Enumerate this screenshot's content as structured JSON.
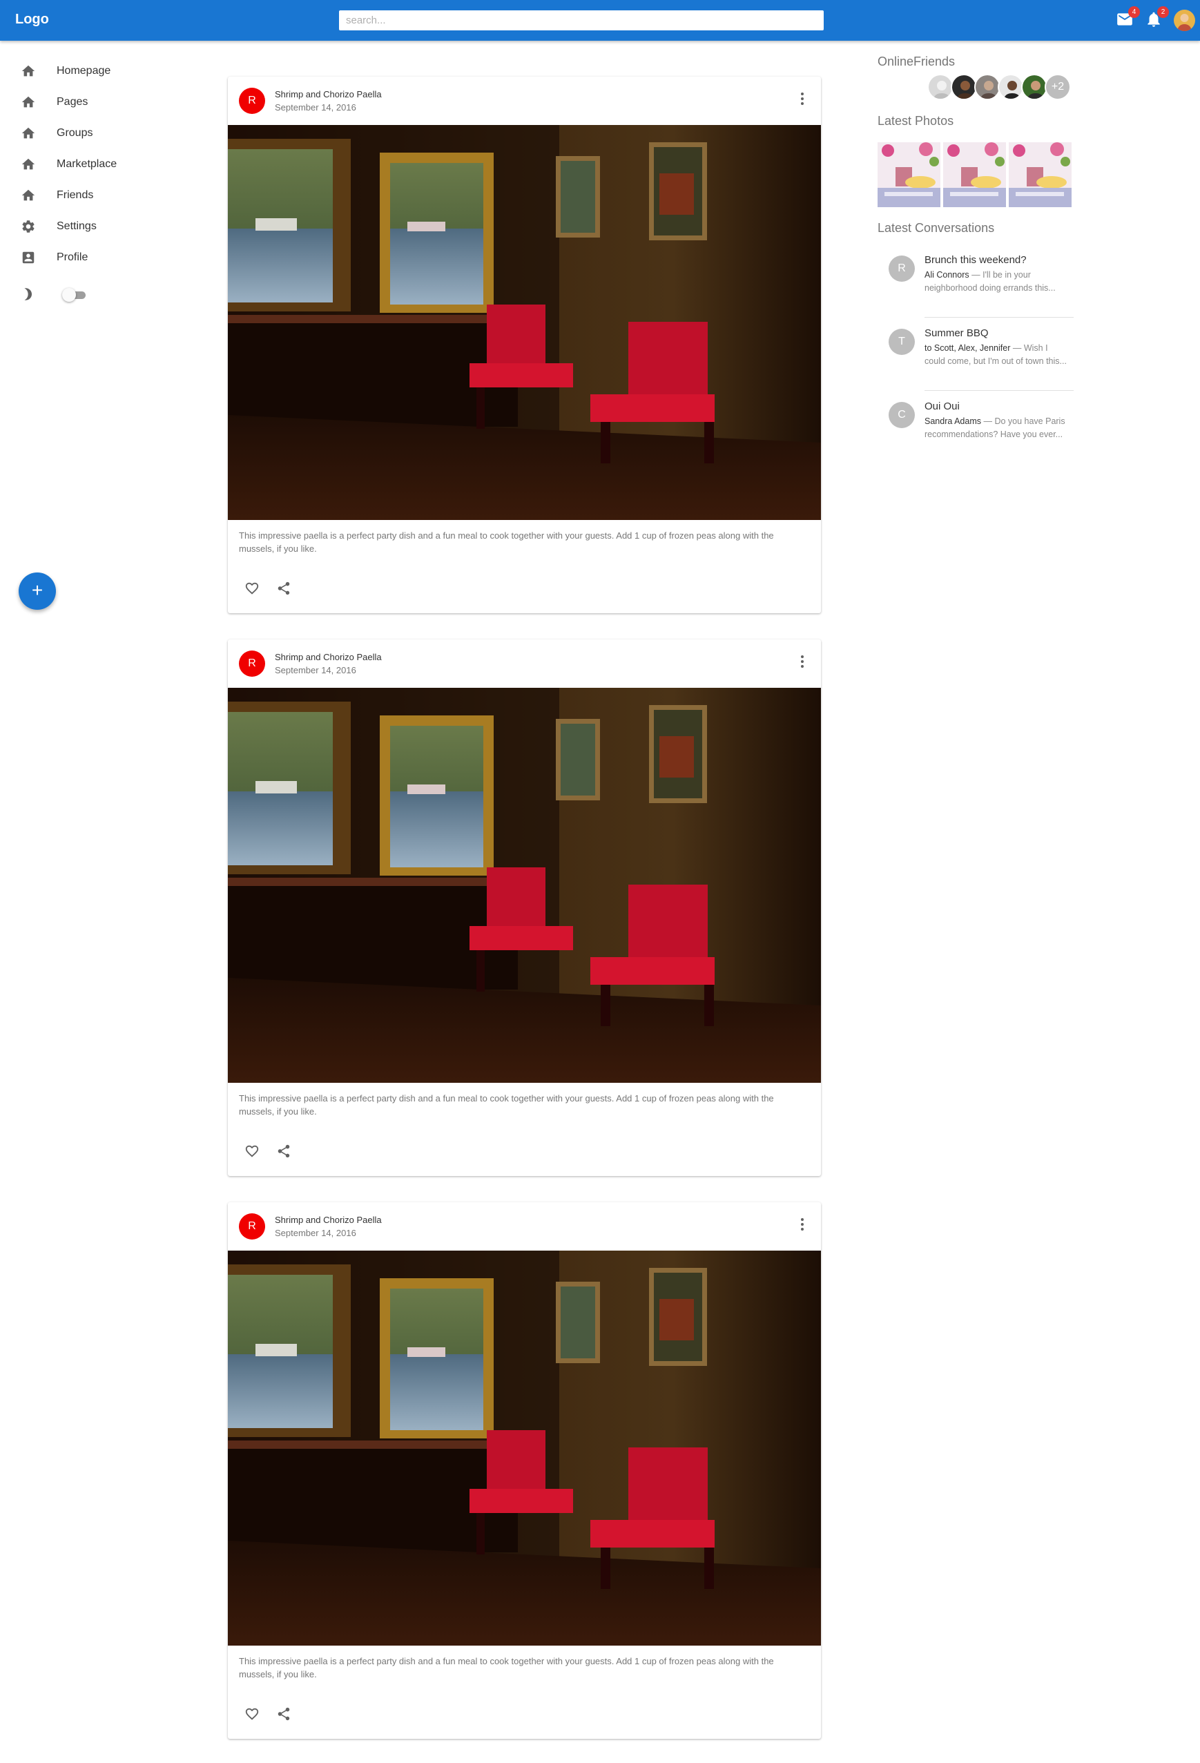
{
  "appbar": {
    "logo": "Logo",
    "search_placeholder": "search...",
    "mail_badge": "4",
    "notifications_badge": "2",
    "icons": [
      "mail-icon",
      "bell-icon"
    ]
  },
  "sidebar": {
    "items": [
      {
        "label": "Homepage",
        "icon": "home-icon"
      },
      {
        "label": "Pages",
        "icon": "home-icon"
      },
      {
        "label": "Groups",
        "icon": "home-icon"
      },
      {
        "label": "Marketplace",
        "icon": "home-icon"
      },
      {
        "label": "Friends",
        "icon": "home-icon"
      },
      {
        "label": "Settings",
        "icon": "gear-icon"
      },
      {
        "label": "Profile",
        "icon": "account-box-icon"
      }
    ],
    "dark_mode_enabled": false,
    "fab_label": "+"
  },
  "posts": [
    {
      "avatar": "R",
      "title": "Shrimp and Chorizo Paella",
      "date": "September 14, 2016",
      "description": "This impressive paella is a perfect party dish and a fun meal to cook together with your guests. Add 1 cup of frozen peas along with the mussels, if you like."
    },
    {
      "avatar": "R",
      "title": "Shrimp and Chorizo Paella",
      "date": "September 14, 2016",
      "description": "This impressive paella is a perfect party dish and a fun meal to cook together with your guests. Add 1 cup of frozen peas along with the mussels, if you like."
    },
    {
      "avatar": "R",
      "title": "Shrimp and Chorizo Paella",
      "date": "September 14, 2016",
      "description": "This impressive paella is a perfect party dish and a fun meal to cook together with your guests. Add 1 cup of frozen peas along with the mussels, if you like."
    }
  ],
  "right": {
    "online_friends_title": "OnlineFriends",
    "online_friends_more": "+2",
    "latest_photos_title": "Latest Photos",
    "latest_conversations_title": "Latest Conversations",
    "conversations": [
      {
        "avatar": "R",
        "subject": "Brunch this weekend?",
        "who": "Ali Connors",
        "snippet": " — I'll be in your neighborhood doing errands this..."
      },
      {
        "avatar": "T",
        "subject": "Summer BBQ",
        "who": "to Scott, Alex, Jennifer",
        "snippet": " — Wish I could come, but I'm out of town this..."
      },
      {
        "avatar": "C",
        "subject": "Oui Oui",
        "who": "Sandra Adams",
        "snippet": " — Do you have Paris recommendations? Have you ever..."
      }
    ]
  },
  "colors": {
    "appbar": "#1976d2",
    "post_avatar": "#f00000",
    "badge": "#e53935"
  }
}
